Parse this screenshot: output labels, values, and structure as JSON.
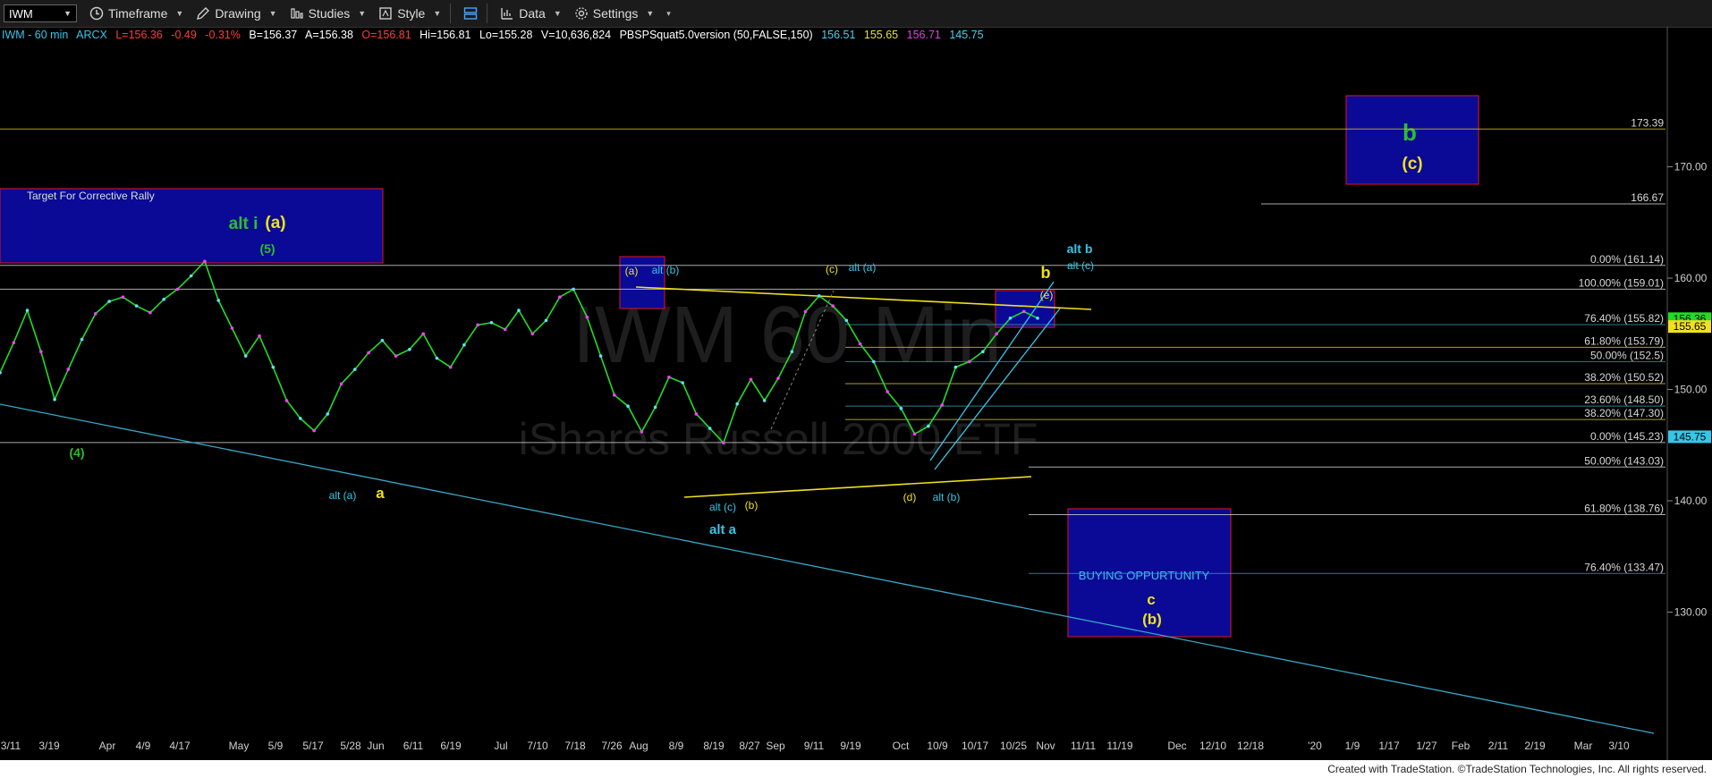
{
  "toolbar": {
    "symbol": "IWM",
    "timeframe": "Timeframe",
    "drawing": "Drawing",
    "studies": "Studies",
    "style": "Style",
    "data": "Data",
    "settings": "Settings"
  },
  "info": {
    "title": "IWM - 60 min",
    "exchange": "ARCX",
    "last": "L=156.36",
    "change": "-0.49",
    "pct": "-0.31%",
    "bid": "B=156.37",
    "ask": "A=156.38",
    "open": "O=156.81",
    "high": "Hi=156.81",
    "low": "Lo=155.28",
    "volume": "V=10,636,824",
    "study": "PBSPSquat5.0version (50,FALSE,150)",
    "v1": "156.51",
    "v2": "155.65",
    "v3": "156.71",
    "v4": "145.75"
  },
  "watermark": {
    "line1": "IWM 60 Min",
    "line2": "iShares Russell 2000 ETF"
  },
  "footer": "Created with TradeStation. ©TradeStation Technologies, Inc. All rights reserved.",
  "colors": {
    "price": "#22dd22",
    "yellow": "#f0e020",
    "cyan": "#36c6e8",
    "green": "#2bbf2b",
    "blue_box": "#0a0a96",
    "red_border": "#c0102a",
    "fib_line": "#6a6a20",
    "fib_blue": "#2a6f7f",
    "axis": "#cfcfcf"
  },
  "chart_data": {
    "type": "line",
    "symbol": "IWM",
    "interval": "60 min",
    "ylim": [
      126,
      175.5
    ],
    "y_ticks": [
      130,
      140,
      150,
      160,
      170
    ],
    "y_tick_labels": [
      "130.00",
      "140.00",
      "150.00",
      "160.00",
      "170.00"
    ],
    "x_tick_labels": [
      "3/11",
      "3/19",
      "Apr",
      "4/9",
      "4/17",
      "May",
      "5/9",
      "5/17",
      "5/28",
      "Jun",
      "6/11",
      "6/19",
      "Jul",
      "7/10",
      "7/18",
      "7/26",
      "Aug",
      "8/9",
      "8/19",
      "8/27",
      "Sep",
      "9/11",
      "9/19",
      "Oct",
      "10/9",
      "10/17",
      "10/25",
      "Nov",
      "11/11",
      "11/19",
      "Dec",
      "12/10",
      "12/18",
      "'20",
      "1/9",
      "1/17",
      "1/27",
      "Feb",
      "2/11",
      "2/19",
      "Mar",
      "3/10"
    ],
    "price_series": {
      "name": "IWM",
      "values": [
        151.5,
        154.2,
        157.1,
        153.4,
        149.1,
        151.8,
        154.5,
        156.8,
        157.9,
        158.3,
        157.5,
        156.9,
        158.1,
        159.0,
        160.2,
        161.5,
        158.0,
        155.5,
        153.0,
        154.8,
        152.0,
        149.0,
        147.4,
        146.3,
        147.8,
        150.5,
        151.8,
        153.3,
        154.4,
        153.0,
        153.6,
        155.0,
        152.8,
        152.0,
        154.0,
        155.8,
        156.0,
        155.4,
        157.1,
        155.0,
        156.2,
        158.3,
        159.0,
        156.5,
        153.0,
        149.5,
        148.5,
        146.2,
        148.4,
        151.1,
        150.6,
        147.8,
        146.5,
        145.2,
        148.7,
        150.9,
        149.0,
        151.0,
        153.4,
        157.0,
        158.4,
        157.5,
        156.2,
        154.1,
        152.5,
        149.8,
        148.3,
        146.0,
        146.7,
        148.6,
        152.0,
        152.5,
        153.4,
        155.0,
        156.4,
        157.0,
        156.4
      ]
    },
    "current_price": "156.36",
    "price_labels": [
      "155.65",
      "145.75"
    ],
    "fib_levels": [
      {
        "label": "173.39",
        "value": 173.39,
        "color": "yellow"
      },
      {
        "label": "166.67",
        "value": 166.67,
        "color": "white"
      },
      {
        "label": "0.00% (161.14)",
        "value": 161.14,
        "color": "white"
      },
      {
        "label": "100.00% (159.01)",
        "value": 159.01,
        "color": "white"
      },
      {
        "label": "76.40% (155.82)",
        "value": 155.82,
        "color": "blue"
      },
      {
        "label": "61.80% (153.79)",
        "value": 153.79,
        "color": "yellow"
      },
      {
        "label": "50.00% (152.5)",
        "value": 152.5,
        "color": "blue"
      },
      {
        "label": "38.20% (150.52)",
        "value": 150.52,
        "color": "yellow"
      },
      {
        "label": "23.60% (148.50)",
        "value": 148.5,
        "color": "blue"
      },
      {
        "label": "38.20% (147.30)",
        "value": 147.3,
        "color": "yellow"
      },
      {
        "label": "0.00% (145.23)",
        "value": 145.23,
        "color": "white"
      },
      {
        "label": "50.00% (143.03)",
        "value": 143.03,
        "color": "white"
      },
      {
        "label": "61.80% (138.76)",
        "value": 138.76,
        "color": "white"
      },
      {
        "label": "76.40% (133.47)",
        "value": 133.47,
        "color": "blue"
      }
    ],
    "boxes": [
      {
        "name": "target-corrective-rally-box",
        "text": "Target For Corrective Rally"
      },
      {
        "name": "b-c-target-box",
        "labels": [
          "b",
          "(c)"
        ]
      },
      {
        "name": "buying-opportunity-box",
        "text": "BUYING OPPURTUNITY",
        "labels": [
          "c",
          "(b)"
        ]
      }
    ],
    "wave_labels": [
      "(4)",
      "alt i",
      "(a)",
      "(5)",
      "alt (a)",
      "a",
      "(a)",
      "alt (b)",
      "(c)",
      "alt (a)",
      "alt (c)",
      "(b)",
      "alt a",
      "(d)",
      "alt (b)",
      "b",
      "(e)",
      "alt b",
      "alt (c)"
    ]
  }
}
